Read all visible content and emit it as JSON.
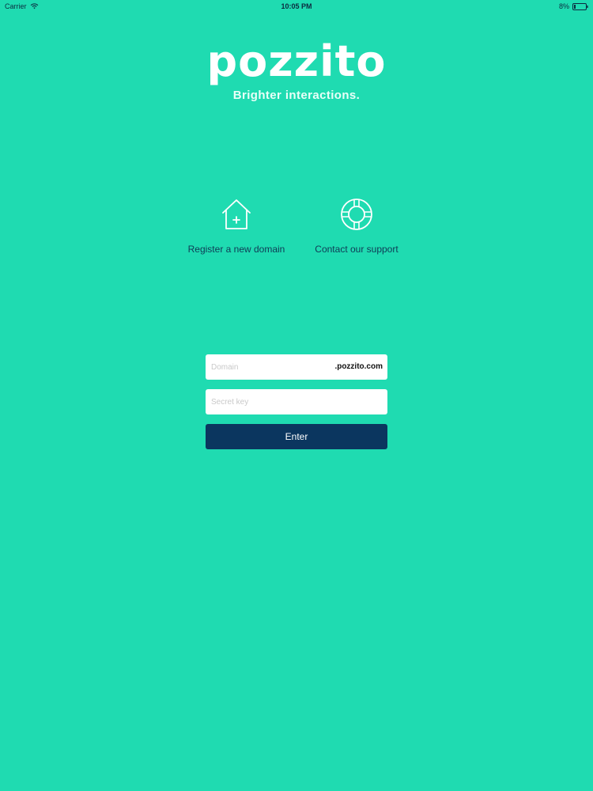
{
  "status_bar": {
    "carrier": "Carrier",
    "time": "10:05 PM",
    "battery": "8%"
  },
  "brand": {
    "logo_text": "pozzito",
    "tagline": "Brighter interactions."
  },
  "actions": [
    {
      "label": "Register a new domain",
      "icon": "house-plus-icon"
    },
    {
      "label": "Contact our support",
      "icon": "lifebuoy-icon"
    }
  ],
  "form": {
    "domain_placeholder": "Domain",
    "domain_value": "",
    "domain_suffix": ".pozzito.com",
    "secret_placeholder": "Secret key",
    "secret_value": "",
    "enter_label": "Enter"
  },
  "colors": {
    "background": "#1fdbb1",
    "button": "#0b365f",
    "text": "#103a55"
  }
}
